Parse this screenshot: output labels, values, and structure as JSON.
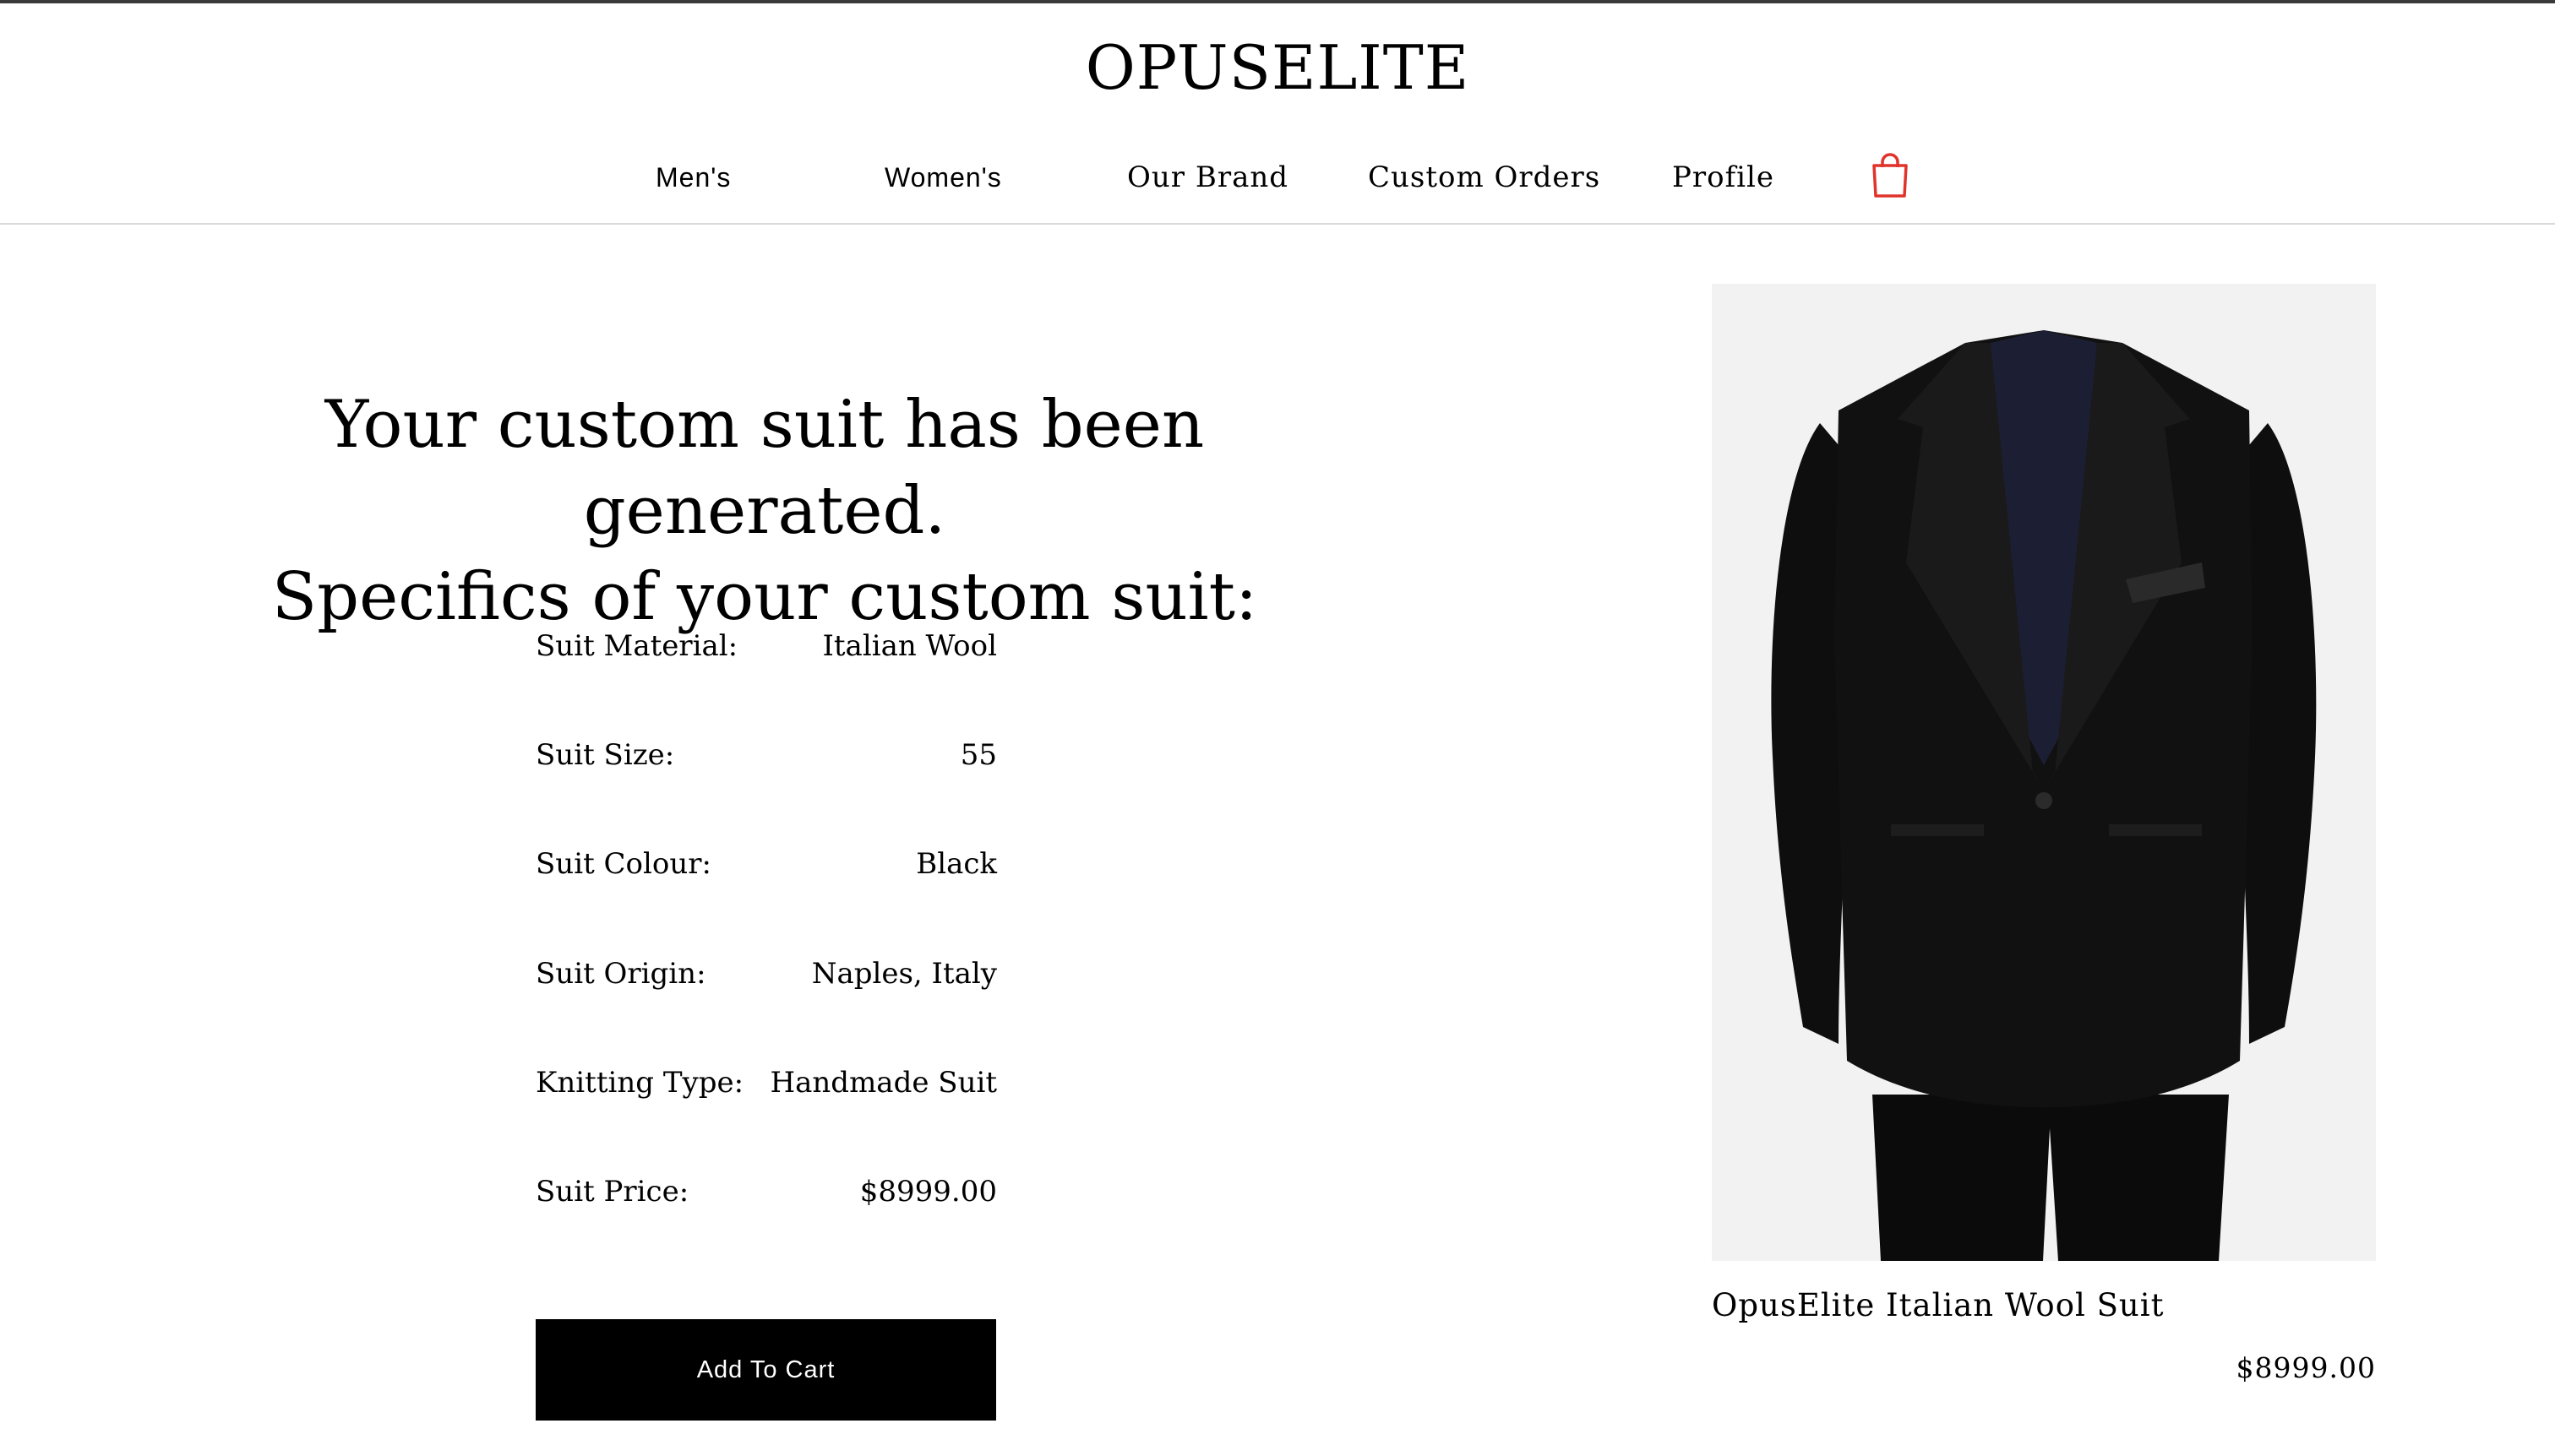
{
  "header": {
    "logo": "OPUSELITE",
    "nav": [
      {
        "label": "Men's"
      },
      {
        "label": "Women's"
      },
      {
        "label": "Our Brand"
      },
      {
        "label": "Custom Orders"
      },
      {
        "label": "Profile"
      }
    ],
    "cart_icon": "shopping-bag-icon",
    "cart_icon_color": "#e0332b"
  },
  "main": {
    "headline_line1": "Your custom suit has been generated.",
    "headline_line2": "Specifics of your custom suit:",
    "specs": [
      {
        "label": "Suit Material:",
        "value": "Italian Wool"
      },
      {
        "label": "Suit Size:",
        "value": "55"
      },
      {
        "label": "Suit Colour:",
        "value": "Black"
      },
      {
        "label": "Suit Origin:",
        "value": "Naples, Italy"
      },
      {
        "label": "Knitting Type:",
        "value": "Handmade Suit"
      },
      {
        "label": "Suit Price:",
        "value": "$8999.00"
      }
    ],
    "add_to_cart_label": "Add To Cart"
  },
  "product": {
    "image": "black-tuxedo-suit-jacket",
    "name": "OpusElite Italian Wool Suit",
    "price": "$8999.00"
  }
}
